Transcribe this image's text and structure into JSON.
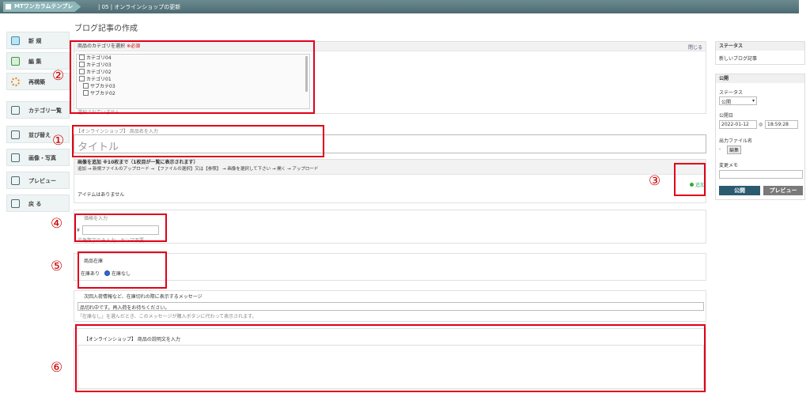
{
  "topbar": {
    "site": "MTワンカラムテンプレ",
    "title": "| 05 | オンラインショップの更新"
  },
  "page": {
    "heading": "ブログ記事の作成"
  },
  "sidebar": {
    "items": [
      {
        "label": "新 規"
      },
      {
        "label": "編 集"
      },
      {
        "label": "再構築"
      },
      {
        "label": "カテゴリ一覧"
      },
      {
        "label": "並び替え"
      },
      {
        "label": "画像・写真"
      },
      {
        "label": "プレビュー"
      },
      {
        "label": "戻 る"
      }
    ]
  },
  "category": {
    "header": "商品のカテゴリを選択",
    "required": "※必須",
    "close": "閉じる",
    "items": [
      "カテゴリ04",
      "カテゴリ03",
      "カテゴリ02",
      "カテゴリ01",
      "サブカテ03",
      "サブカテ02"
    ],
    "none_selected": "選択されていません"
  },
  "title": {
    "label": "【オンラインショップ】 商品名を入力",
    "placeholder": "タイトル"
  },
  "images": {
    "header": "画像を追加 ※10枚まで（1枚目が一覧に表示されます）",
    "help": "追加 → 新規ファイルのアップロード → 【ファイルの選択】又は【参照】 → 画像を選択して下さい → 開く → アップロード",
    "add": "追加",
    "empty": "アイテムはありません"
  },
  "price": {
    "label": "価格を入力",
    "currency": "¥",
    "note": "半角数字のみ入力。カンマ不要"
  },
  "stock": {
    "label": "商品在庫",
    "options": [
      "在庫あり",
      "在庫なし"
    ]
  },
  "message": {
    "label": "次回入荷情報など、在庫切れの際に表示するメッセージ",
    "value": "品切れ中です。再入荷をお待ちください。",
    "note": "「在庫なし」を選んだとき、このメッセージが購入ボタンに代わって表示されます。"
  },
  "description": {
    "label": "【オンラインショップ】 商品の説明文を入力"
  },
  "annotations": [
    "①",
    "②",
    "③",
    "④",
    "⑤",
    "⑥"
  ],
  "right": {
    "status_header": "ステータス",
    "status_text": "新しいブログ記事",
    "publish_header": "公開",
    "status_label": "ステータス",
    "status_value": "公開",
    "date_label": "公開日",
    "date_value": "2022-01-12",
    "time_value": "18:59:28",
    "file_label": "出力ファイル名",
    "file_value": "-",
    "file_edit": "編集",
    "memo_label": "変更メモ",
    "publish_btn": "公開",
    "preview_btn": "プレビュー"
  },
  "colors": {
    "accent": "#4d6b72",
    "annotation": "#e1001a",
    "primary_btn": "#2b5b6e",
    "secondary_btn": "#7a7a7a"
  }
}
